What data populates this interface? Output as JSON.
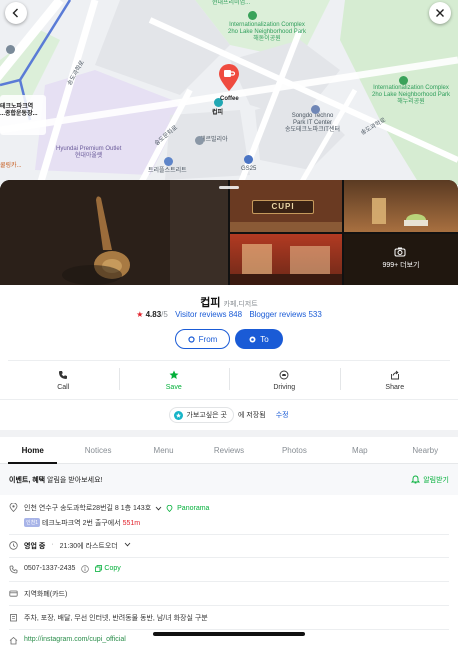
{
  "map": {
    "labels": {
      "hyundai_top": "현대프리미엄...",
      "intl_complex_top": "Internationalization Complex\n2ho Lake Neighborhood Park\n해돋이공원",
      "intl_complex_right": "Internationalization Complex\n2ho Lake Neighborhood Park\n해누리공원",
      "songdo_techno": "Songdo Techno\nPark IT Center\n송도테크노파크IT센터",
      "hyundai_outlet": "Hyundai Premium Outlet\n현대아울렛",
      "pin_label": "Coffee",
      "pin_name": "컵피",
      "station_name": "테크노파크역\n...종합운동장...",
      "trefle": "트리플스트리트",
      "herb": "헤르빌리아",
      "gs25": "GS25",
      "coffeebean": "쿨링카...",
      "road1": "송도과학로",
      "road2": "송도문화로",
      "road3": "송도과학로"
    }
  },
  "photos": {
    "sign_text": "CUPI",
    "more_label": "999+ 더보기"
  },
  "place": {
    "name": "컵피",
    "category": "카페,디저트",
    "rating": "4.83",
    "rating_max": "/5",
    "visitor_reviews": "Visitor reviews 848",
    "blogger_reviews": "Blogger reviews 533"
  },
  "route": {
    "from_label": "From",
    "to_label": "To"
  },
  "actions": [
    {
      "label": "Call",
      "icon": "phone-icon"
    },
    {
      "label": "Save",
      "icon": "star-icon"
    },
    {
      "label": "Driving",
      "icon": "car-icon"
    },
    {
      "label": "Share",
      "icon": "share-icon"
    }
  ],
  "saved": {
    "chip_label": "가보고싶은 곳",
    "suffix": "에 저장됨",
    "edit_label": "수정"
  },
  "tabs": [
    "Home",
    "Notices",
    "Menu",
    "Reviews",
    "Photos",
    "Map",
    "Nearby"
  ],
  "notice": {
    "text_bold": "이벤트, 혜택",
    "text_rest": " 알림을 받아보세요!",
    "button_label": "알림받기"
  },
  "info": {
    "address": "인천 연수구 송도과학로28번길 8 1층 143호",
    "panorama_label": "Panorama",
    "subway_line": "인천1",
    "subway_text": "테크노파크역 2번 출구에서",
    "subway_distance": "551m",
    "hours_status": "영업 중",
    "hours_detail": "21:30에 라스트오더",
    "phone": "0507-1337-2435",
    "copy_label": "Copy",
    "payment": "지역화폐(카드)",
    "amenities": "주차, 포장, 배달, 무선 인터넷, 반려동물 동반, 남/녀 화장실 구분",
    "website": "http://instagram.com/cupi_official"
  },
  "colors": {
    "accent_blue": "#1a5bd6",
    "naver_green": "#03b03a",
    "rating_red": "#e2202a"
  }
}
